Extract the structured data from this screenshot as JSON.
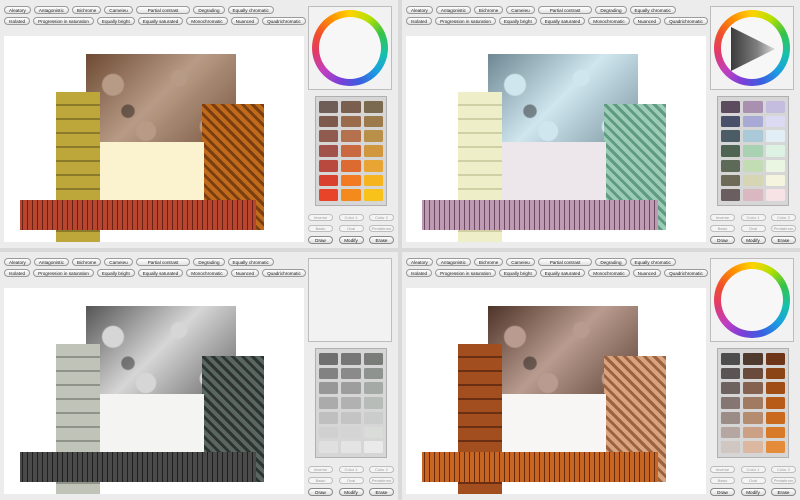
{
  "top_buttons": [
    "Aleatory",
    "Antagonistic",
    "Bichrome",
    "Cameieu",
    "Partial contrast",
    "Degrading",
    "Equally chromatic"
  ],
  "bottom_buttons": [
    "Isolated",
    "Progression in saturation",
    "Equally bright",
    "Equally saturated",
    "Monochromatic",
    "Nuanced",
    "Quadrichromatic"
  ],
  "color_controls": [
    "Inverse",
    "Color 1",
    "Color 2",
    "Basic",
    "Oval",
    "Pentabrum"
  ],
  "actions": [
    "Draw",
    "Modify",
    "Erase"
  ],
  "panes": [
    {
      "name": "warm-earth",
      "colors": {
        "rock": "#6d4a33",
        "rock_hi": "#b89b86",
        "pillar": "#bda63a",
        "pillar_dark": "#8a7a2a",
        "copper": "#c06a1c",
        "copper_dark": "#7a3e10",
        "cream": "#fbf2cf",
        "granite": "#b8452e",
        "granite_dark": "#6a2014"
      },
      "wheel": true,
      "triangle": false,
      "palette": [
        "#6f5e57",
        "#7a5e4e",
        "#7a6a4f",
        "#7e5a4d",
        "#9a6a4d",
        "#9d7a4c",
        "#8f5b4e",
        "#b5714d",
        "#b9904a",
        "#a0524b",
        "#c8693f",
        "#d1973e",
        "#b9493f",
        "#dd6a30",
        "#e8a533",
        "#d9402e",
        "#f27a22",
        "#f6b51f",
        "#e8442a",
        "#f48a1c",
        "#f9c21a"
      ]
    },
    {
      "name": "pastel",
      "colors": {
        "rock": "#6e8792",
        "rock_hi": "#cfe6ef",
        "pillar": "#eeeec8",
        "pillar_dark": "#d0d0a4",
        "copper": "#9ccbb6",
        "copper_dark": "#5f9a82",
        "cream": "#ede6ea",
        "granite": "#bf9ab3",
        "granite_dark": "#6e4a62"
      },
      "wheel": true,
      "triangle": true,
      "palette": [
        "#5c4a5f",
        "#a98fb0",
        "#c4bde0",
        "#48506a",
        "#a9a9d6",
        "#dcd9f2",
        "#4c5c66",
        "#a9c9d8",
        "#e1eef5",
        "#4f6453",
        "#a8d2b2",
        "#def2e3",
        "#5e6a58",
        "#c2dcb4",
        "#eaf6e2",
        "#6d6a58",
        "#d6d6b4",
        "#f5f4de",
        "#6b5e5e",
        "#d9b8bf",
        "#f7e2e6"
      ]
    },
    {
      "name": "grayscale",
      "colors": {
        "rock": "#555555",
        "rock_hi": "#d6d6d6",
        "pillar": "#bfc3b8",
        "pillar_dark": "#8f948a",
        "copper": "#5a6660",
        "copper_dark": "#2c3330",
        "cream": "#f4f5f2",
        "granite": "#4a4a4a",
        "granite_dark": "#1f1f1f"
      },
      "wheel": false,
      "triangle": false,
      "palette": [
        "#6f6f6f",
        "#767676",
        "#7a7c7a",
        "#828282",
        "#8a8a8a",
        "#8f9390",
        "#979797",
        "#9d9d9d",
        "#a5aaa6",
        "#ababab",
        "#b1b1b1",
        "#b8bcb9",
        "#bfbfbf",
        "#c4c4c4",
        "#cacdcb",
        "#d0d0d0",
        "#d4d4d4",
        "#dadcd9",
        "#e0e0e0",
        "#e4e4e4",
        "#eaeaea"
      ]
    },
    {
      "name": "rust",
      "colors": {
        "rock": "#4e3328",
        "rock_hi": "#b99c8f",
        "pillar": "#a34e1f",
        "pillar_dark": "#6a2e10",
        "copper": "#d9a37e",
        "copper_dark": "#9a6240",
        "cream": "#f8f6f5",
        "granite": "#c76522",
        "granite_dark": "#6a2a0c"
      },
      "wheel": true,
      "triangle": false,
      "palette": [
        "#4d4d4d",
        "#4f3a30",
        "#6e3518",
        "#5a5554",
        "#6a4a3a",
        "#8a4416",
        "#6e6260",
        "#856250",
        "#a14e16",
        "#857673",
        "#a17a62",
        "#b85a18",
        "#9b8c88",
        "#b68c70",
        "#c96a1e",
        "#b6a6a1",
        "#cba085",
        "#d77a2a",
        "#d0c6c2",
        "#ddb8a0",
        "#e48c3a"
      ]
    }
  ]
}
